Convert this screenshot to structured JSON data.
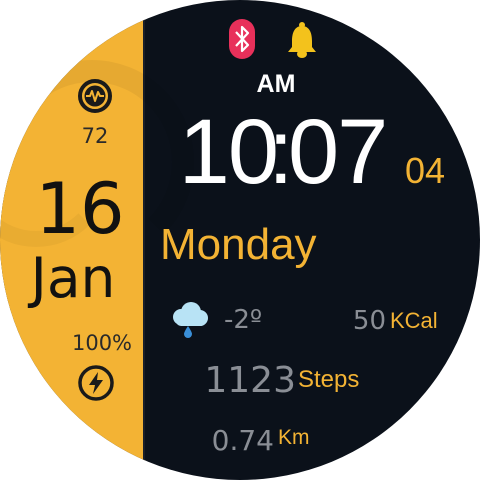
{
  "left_panel": {
    "heart_rate": "72",
    "day": "16",
    "month": "Jan",
    "battery": "100%",
    "heart_icon": "heart-rate-icon",
    "bolt_icon": "charging-bolt-icon"
  },
  "status": {
    "bluetooth_icon": "bluetooth-icon",
    "alarm_icon": "bell-icon"
  },
  "time": {
    "ampm": "AM",
    "hours": "10",
    "colon": ":",
    "minutes": "07",
    "seconds": "04"
  },
  "weekday": "Monday",
  "weather": {
    "icon": "rain-cloud-icon",
    "temperature": "-2º"
  },
  "calories": {
    "value": "50",
    "unit": "KCal"
  },
  "steps": {
    "value": "1123",
    "unit": "Steps"
  },
  "distance": {
    "value": "0.74",
    "unit": "Km"
  },
  "colors": {
    "accent": "#f3b334",
    "background": "#0b111a",
    "bluetooth": "#e8305a",
    "muted_text": "#8a8e95"
  }
}
